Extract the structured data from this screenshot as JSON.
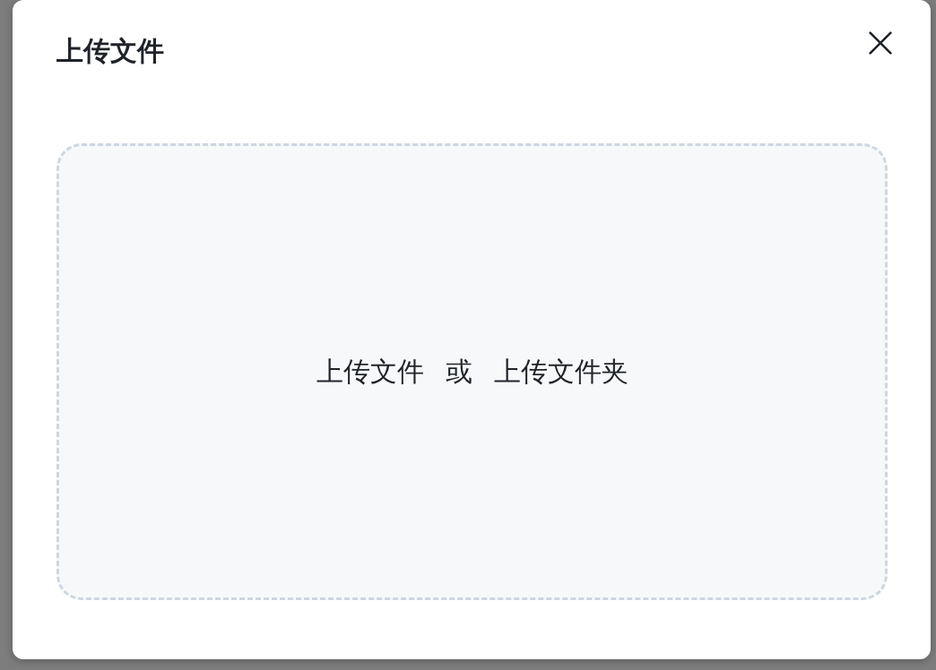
{
  "dialog": {
    "title": "上传文件",
    "drop_zone": {
      "upload_file_link": "上传文件",
      "separator": "或",
      "upload_folder_link": "上传文件夹"
    }
  }
}
